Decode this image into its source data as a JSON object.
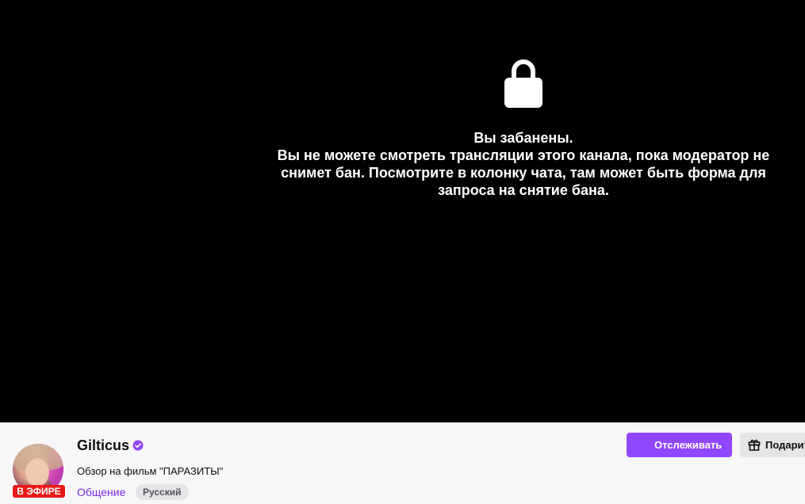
{
  "player": {
    "ban_title": "Вы забанены.",
    "ban_line1": "Вы не можете смотреть трансляции этого канала, пока модератор не",
    "ban_line2": "снимет бан. Посмотрите в колонку чата, там может быть форма для",
    "ban_line3": "запроса на снятие бана.",
    "icon": "lock-icon"
  },
  "channel": {
    "name": "Gilticus",
    "live_badge": "В ЭФИРЕ",
    "stream_title": "Обзор на фильм \"ПАРАЗИТЫ\"",
    "category": "Общение",
    "tag": "Русский",
    "verified_icon": "verified-badge-icon"
  },
  "actions": {
    "follow_label": "Отслеживать",
    "gift_label": "Подарить",
    "gift_icon": "gift-icon"
  },
  "colors": {
    "accent": "#9147ff",
    "link": "#772ce8",
    "live": "#e91916",
    "player_bg": "#000000"
  }
}
